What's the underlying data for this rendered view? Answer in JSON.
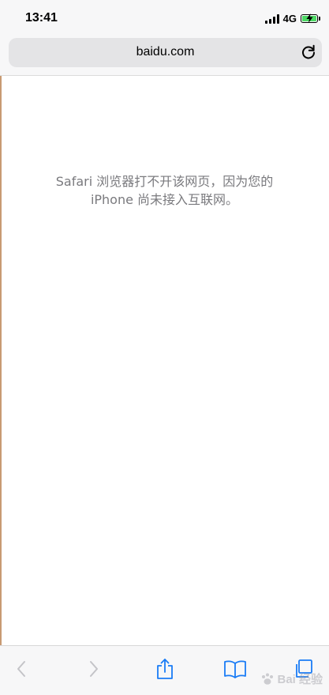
{
  "status_bar": {
    "time": "13:41",
    "network": "4G",
    "battery_color": "#4cd964"
  },
  "address_bar": {
    "url": "baidu.com",
    "reload_icon": "reload-icon"
  },
  "content": {
    "error_line1": "Safari 浏览器打不开该网页，因为您的",
    "error_line2": "iPhone 尚未接入互联网。"
  },
  "toolbar": {
    "back_icon": "chevron-left-icon",
    "forward_icon": "chevron-right-icon",
    "share_icon": "share-icon",
    "bookmarks_icon": "book-icon",
    "tabs_icon": "tabs-icon",
    "accent_color": "#1a7cf5",
    "disabled_color": "#c4c4c8"
  },
  "watermark": {
    "text": "Bai 经验"
  }
}
